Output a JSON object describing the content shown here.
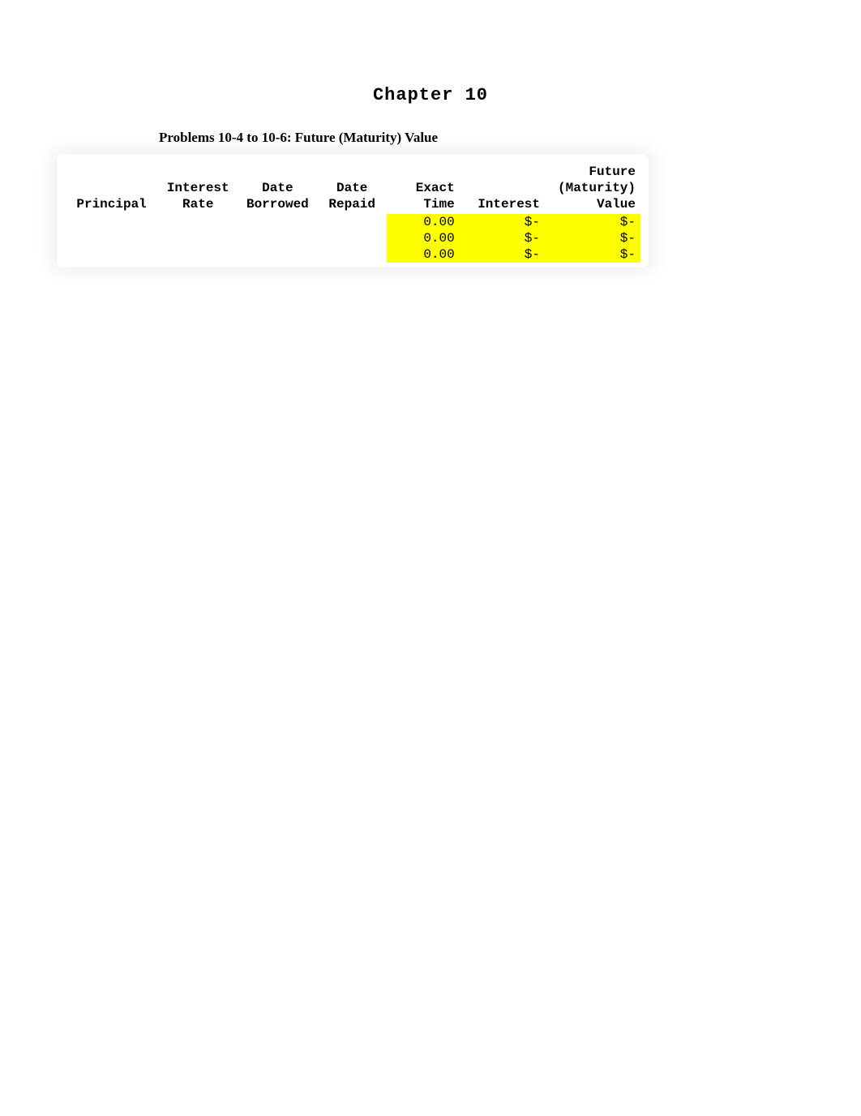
{
  "title": "Chapter 10",
  "subtitle": "Problems 10-4 to 10-6: Future (Maturity) Value",
  "columns": {
    "principal": "Principal",
    "rate_line1": "Interest",
    "rate_line2": "Rate",
    "borrowed_line1": "Date",
    "borrowed_line2": "Borrowed",
    "repaid_line1": "Date",
    "repaid_line2": "Repaid",
    "time_line1": "Exact",
    "time_line2": "Time",
    "interest": "Interest",
    "future_line1": "Future",
    "future_line2": "(Maturity)",
    "future_line3": "Value"
  },
  "rows": [
    {
      "principal": "",
      "rate": "",
      "borrowed": "",
      "repaid": "",
      "time": "0.00",
      "interest": "$-",
      "future": "$-"
    },
    {
      "principal": "",
      "rate": "",
      "borrowed": "",
      "repaid": "",
      "time": "0.00",
      "interest": "$-",
      "future": "$-"
    },
    {
      "principal": "",
      "rate": "",
      "borrowed": "",
      "repaid": "",
      "time": "0.00",
      "interest": "$-",
      "future": "$-"
    }
  ]
}
